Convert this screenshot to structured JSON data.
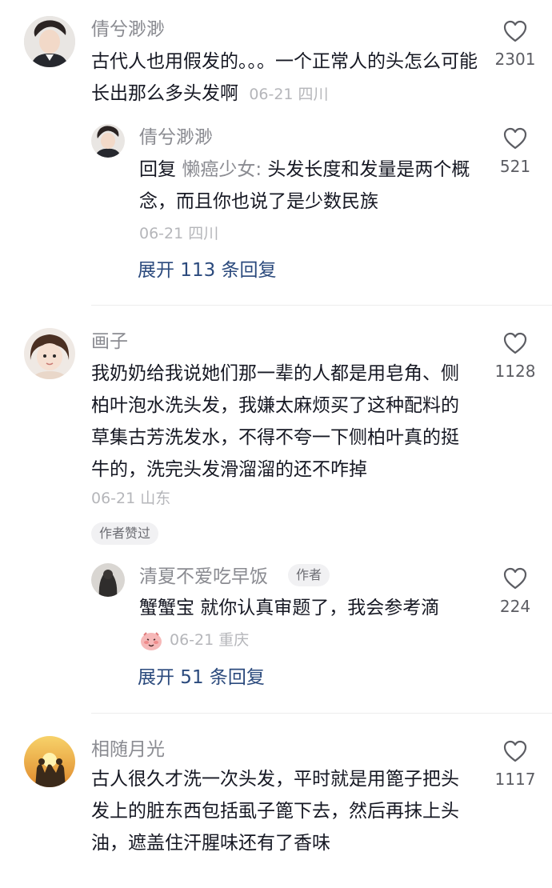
{
  "comments": [
    {
      "user": "倩兮渺渺",
      "text": "古代人也用假发的。。。一个正常人的头怎么可能长出那么多头发啊",
      "meta": "06-21 四川",
      "likes": "2301",
      "reply": {
        "user": "倩兮渺渺",
        "prefix": "回复",
        "mention": "懒癌少女:",
        "text": "头发长度和发量是两个概念，而且你也说了是少数民族",
        "meta": "06-21 四川",
        "likes": "521"
      },
      "expand": "展开 113 条回复"
    },
    {
      "user": "画子",
      "text": "我奶奶给我说她们那一辈的人都是用皂角、侧柏叶泡水洗头发，我嫌太麻烦买了这种配料的草集古芳洗发水，不得不夸一下侧柏叶真的挺牛的，洗完头发滑溜溜的还不咋掉",
      "meta": "06-21 山东",
      "likes": "1128",
      "badge": "作者赞过",
      "reply": {
        "user": "清夏不爱吃早饭",
        "author_tag": "作者",
        "text": "蟹蟹宝 就你认真审题了，我会参考滴",
        "meta": "06-21 重庆",
        "likes": "224"
      },
      "expand": "展开 51 条回复"
    },
    {
      "user": "相随月光",
      "text": "古人很久才洗一次头发，平时就是用篦子把头发上的脏东西包括虱子篦下去，然后再抹上头油，遮盖住汗腥味还有了香味",
      "likes": "1117"
    }
  ],
  "icons": {
    "like": "heart-outline-icon",
    "emoji": "blushing-face-emoji"
  },
  "colors": {
    "username": "#8a8b91",
    "text": "#161823",
    "meta": "#b5b6ba",
    "expand": "#2b4a7d",
    "like_count": "#5c5d63"
  }
}
